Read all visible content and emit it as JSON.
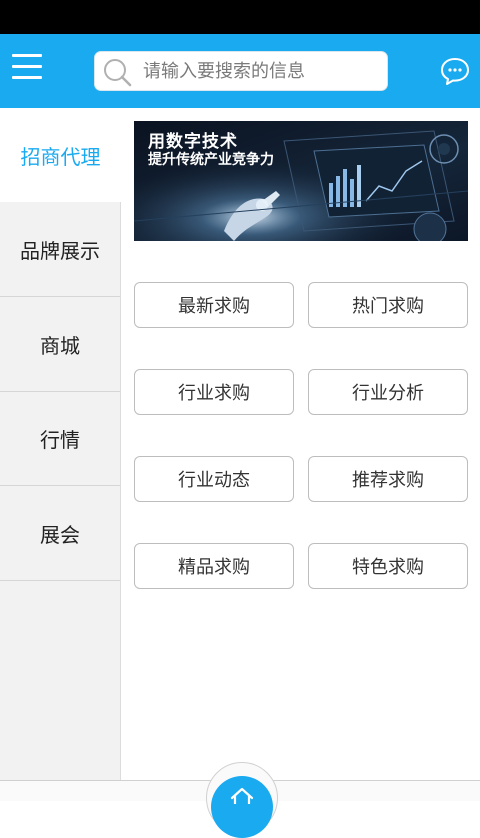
{
  "search": {
    "placeholder": "请输入要搜索的信息",
    "value": ""
  },
  "sidebar": {
    "items": [
      {
        "label": "招商代理",
        "active": true
      },
      {
        "label": "品牌展示"
      },
      {
        "label": "商城"
      },
      {
        "label": "行情"
      },
      {
        "label": "展会"
      }
    ]
  },
  "banner": {
    "title": "用数字技术",
    "subtitle": "提升传统产业竞争力"
  },
  "grid": {
    "buttons": [
      "最新求购",
      "热门求购",
      "行业求购",
      "行业分析",
      "行业动态",
      "推荐求购",
      "精品求购",
      "特色求购"
    ]
  },
  "colors": {
    "accent": "#1aaaf0",
    "sidebar_bg": "#f2f2f2"
  },
  "icons": {
    "menu": "menu-icon",
    "search": "search-icon",
    "chat": "chat-icon",
    "home": "home-icon"
  }
}
